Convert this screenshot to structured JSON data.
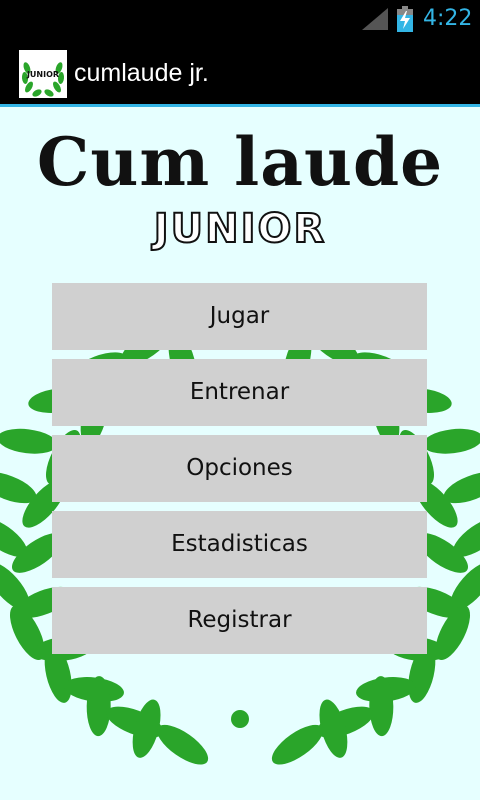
{
  "status_bar": {
    "time": "4:22",
    "signal_icon": "signal-icon",
    "battery_icon": "battery-charging-icon",
    "accent_color": "#33b5e5"
  },
  "action_bar": {
    "title": "cumlaude jr.",
    "icon": "app-logo-icon",
    "icon_text": "JUNIOR"
  },
  "logo": {
    "title": "Cum laude",
    "subtitle": "JUNIOR"
  },
  "menu": {
    "buttons": [
      "Jugar",
      "Entrenar",
      "Opciones",
      "Estadisticas",
      "Registrar"
    ]
  },
  "colors": {
    "background": "#e6ffff",
    "button": "#d0d0d0",
    "leaf": "#2aa52a"
  }
}
